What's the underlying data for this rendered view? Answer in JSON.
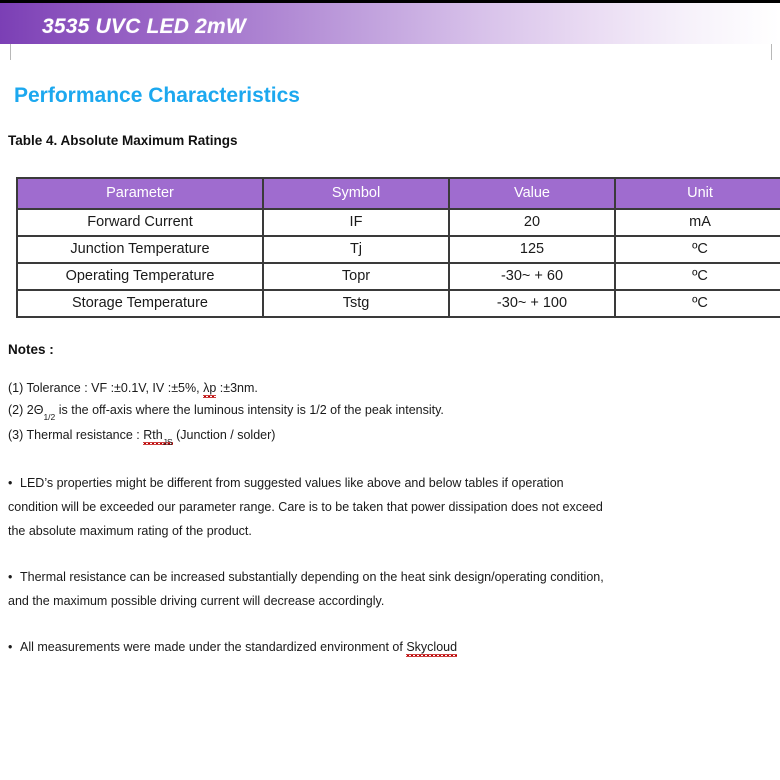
{
  "banner": {
    "title": "3535 UVC LED 2mW",
    "gradient_start": "#7b3fb5",
    "gradient_end": "#ffffff"
  },
  "section": {
    "heading": "Performance Characteristics",
    "heading_color": "#1ca8ef"
  },
  "table": {
    "caption": "Table 4. Absolute Maximum Ratings",
    "header_bg": "#9f6ccf",
    "header_text_color": "#ffffff",
    "columns": [
      "Parameter",
      "Symbol",
      "Value",
      "Unit"
    ],
    "rows": [
      {
        "parameter": "Forward Current",
        "symbol": "IF",
        "value": "20",
        "unit": "mA"
      },
      {
        "parameter": "Junction Temperature",
        "symbol": "Tj",
        "value": "125",
        "unit": "ºC"
      },
      {
        "parameter": "Operating Temperature",
        "symbol": "Topr",
        "value": "-30~ + 60",
        "unit": "ºC"
      },
      {
        "parameter": "Storage Temperature",
        "symbol": "Tstg",
        "value": "-30~ + 100",
        "unit": "ºC"
      }
    ]
  },
  "notes": {
    "title": "Notes :",
    "item1_prefix": "(1) Tolerance : VF :±0.1V, IV :±5%,  ",
    "item1_spell": "λp",
    "item1_suffix": " :±3nm.",
    "item2_prefix": "(2) 2Θ",
    "item2_sub": "1/2",
    "item2_suffix": " is the off-axis where the luminous intensity is 1/2 of the peak intensity.",
    "item3_prefix": "(3) Thermal resistance : ",
    "item3_spell": "Rth",
    "item3_spell_sub": "JS",
    "item3_suffix": " (Junction / solder)"
  },
  "bullets": {
    "mark": "•",
    "item1": "LED’s properties might be different from suggested values like above and below tables if operation condition will be exceeded our parameter range. Care is to be taken that power dissipation does not exceed the absolute maximum rating of the product.",
    "item2": "Thermal resistance can be increased substantially depending on the heat sink design/operating condition, and the maximum possible driving current will decrease accordingly.",
    "item3_prefix": "All measurements were made under the standardized environment of ",
    "item3_spell": "Skycloud"
  }
}
